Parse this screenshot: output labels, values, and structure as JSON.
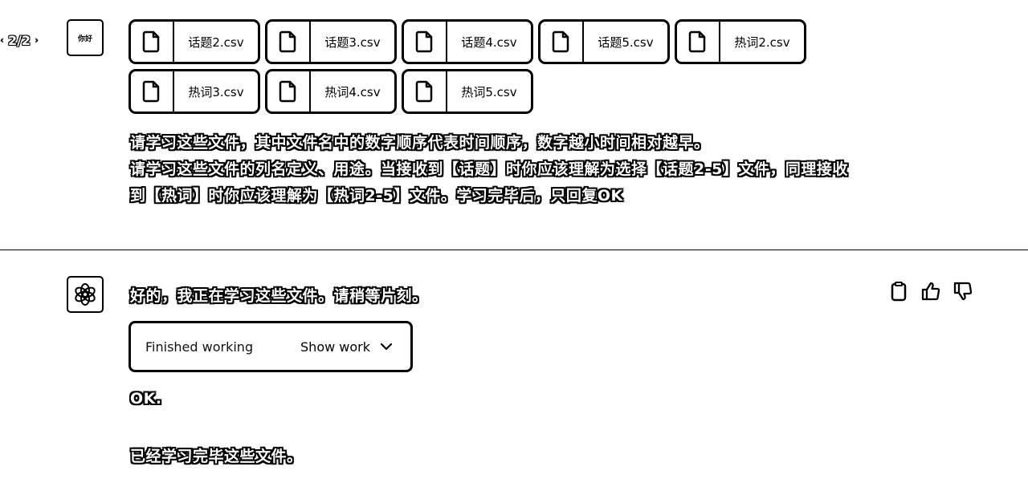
{
  "pager": {
    "count": "2/2",
    "prev_icon": "chevron-left-icon",
    "next_icon": "chevron-right-icon"
  },
  "user_avatar": {
    "text": "你好"
  },
  "files": [
    "话题2.csv",
    "话题3.csv",
    "话题4.csv",
    "话题5.csv",
    "热词2.csv",
    "热词3.csv",
    "热词4.csv",
    "热词5.csv"
  ],
  "user_message": {
    "line1": "请学习这些文件，其中文件名中的数字顺序代表时间顺序，数字越小时间相对越早。",
    "line2": "请学习这些文件的列名定义、用途。当接收到【话题】时你应该理解为选择【话题2-5】文件，同理接收到【热词】时你应该理解为【热词2-5】文件。学习完毕后，只回复OK"
  },
  "assistant": {
    "intro": "好的，我正在学习这些文件。请稍等片刻。",
    "work_status": "Finished working",
    "show_work": "Show work",
    "reply1": "OK.",
    "reply2": "已经学习完毕这些文件。"
  }
}
